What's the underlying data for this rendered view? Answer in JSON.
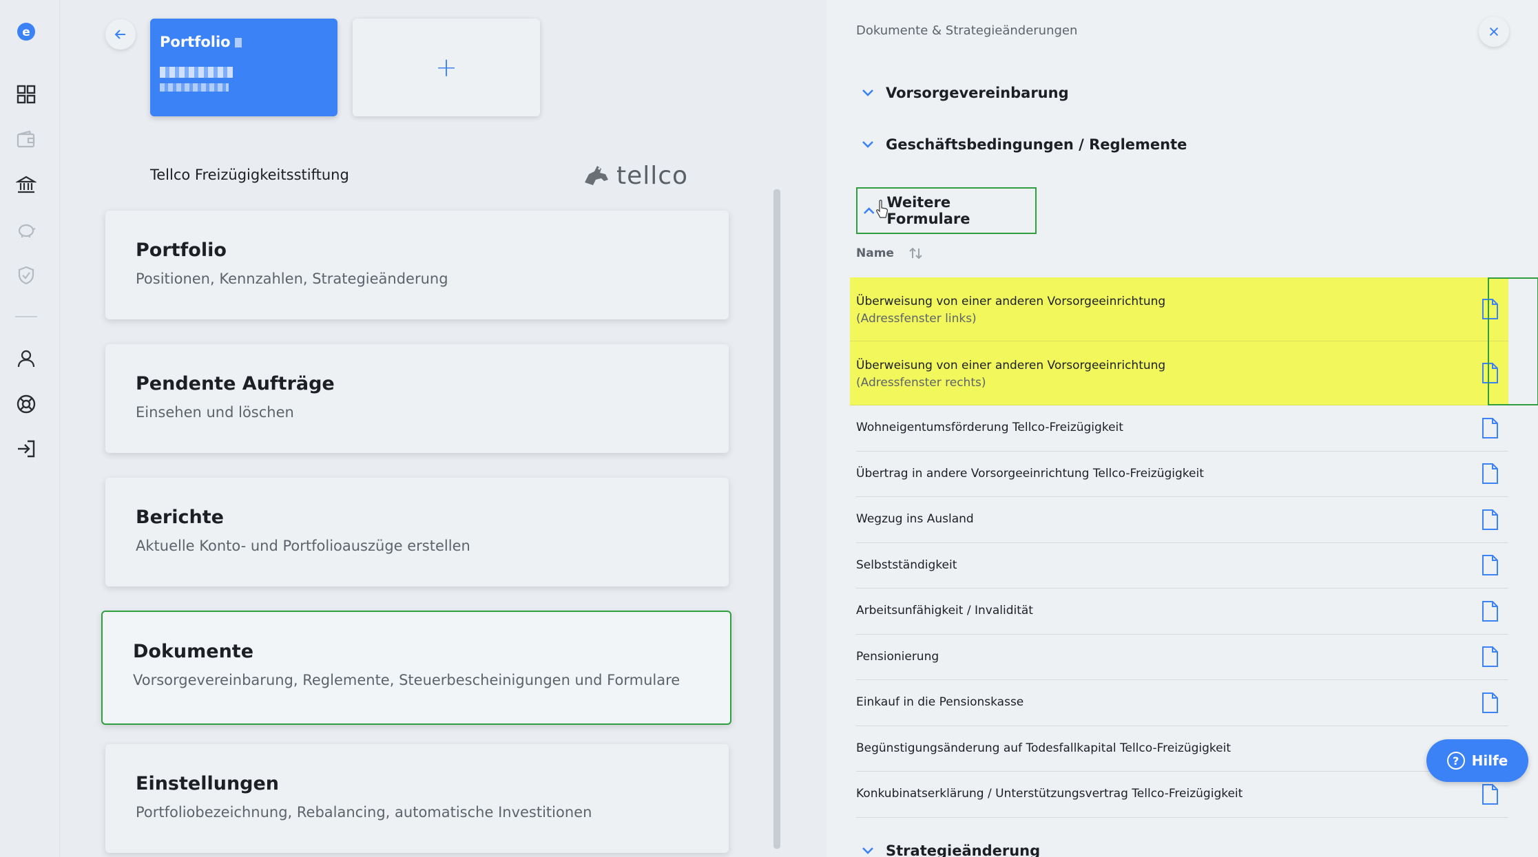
{
  "rail": {
    "logo": "e",
    "icons": [
      "dashboard-icon",
      "wallet-icon",
      "bank-icon",
      "piggy-bank-icon",
      "shield-check-icon",
      "user-icon",
      "lifebuoy-icon",
      "logout-icon"
    ]
  },
  "portfolio_card": {
    "title": "Portfolio"
  },
  "add_card": {
    "label": "+"
  },
  "provider": {
    "name": "Tellco Freizügigkeitsstiftung",
    "logo_text": "tellco"
  },
  "menu": [
    {
      "title": "Portfolio",
      "subtitle": "Positionen, Kennzahlen, Strategieänderung"
    },
    {
      "title": "Pendente Aufträge",
      "subtitle": "Einsehen und löschen"
    },
    {
      "title": "Berichte",
      "subtitle": "Aktuelle Konto- und Portfolioauszüge erstellen"
    },
    {
      "title": "Dokumente",
      "subtitle": "Vorsorgevereinbarung, Reglemente, Steuerbescheinigungen und Formulare"
    },
    {
      "title": "Einstellungen",
      "subtitle": "Portfoliobezeichnung, Rebalancing, automatische Investitionen"
    }
  ],
  "panel": {
    "header": "Dokumente & Strategieänderungen",
    "sections": {
      "s1": "Vorsorgevereinbarung",
      "s2": "Geschäftsbedingungen / Reglemente",
      "s3": "Weitere Formulare",
      "s4": "Strategieänderung"
    },
    "sort_label": "Name",
    "documents": [
      {
        "title": "Überweisung von einer anderen Vorsorgeeinrichtung",
        "sub": "(Adressfenster links)"
      },
      {
        "title": "Überweisung von einer anderen Vorsorgeeinrichtung",
        "sub": "(Adressfenster rechts)"
      },
      {
        "title": "Wohneigentumsförderung Tellco-Freizügigkeit"
      },
      {
        "title": "Übertrag in andere Vorsorgeeinrichtung Tellco-Freizügigkeit"
      },
      {
        "title": "Wegzug ins Ausland"
      },
      {
        "title": "Selbstständigkeit"
      },
      {
        "title": "Arbeitsunfähigkeit / Invalidität"
      },
      {
        "title": "Pensionierung"
      },
      {
        "title": "Einkauf in die Pensionskasse"
      },
      {
        "title": "Begünstigungsänderung auf Todesfallkapital Tellco-Freizügigkeit"
      },
      {
        "title": "Konkubinatserklärung / Unterstützungsvertrag Tellco-Freizügigkeit"
      }
    ]
  },
  "help": {
    "label": "Hilfe"
  },
  "colors": {
    "accent": "#3b82f6",
    "highlight": "#f2f75c",
    "focus": "#2e9e3e"
  }
}
